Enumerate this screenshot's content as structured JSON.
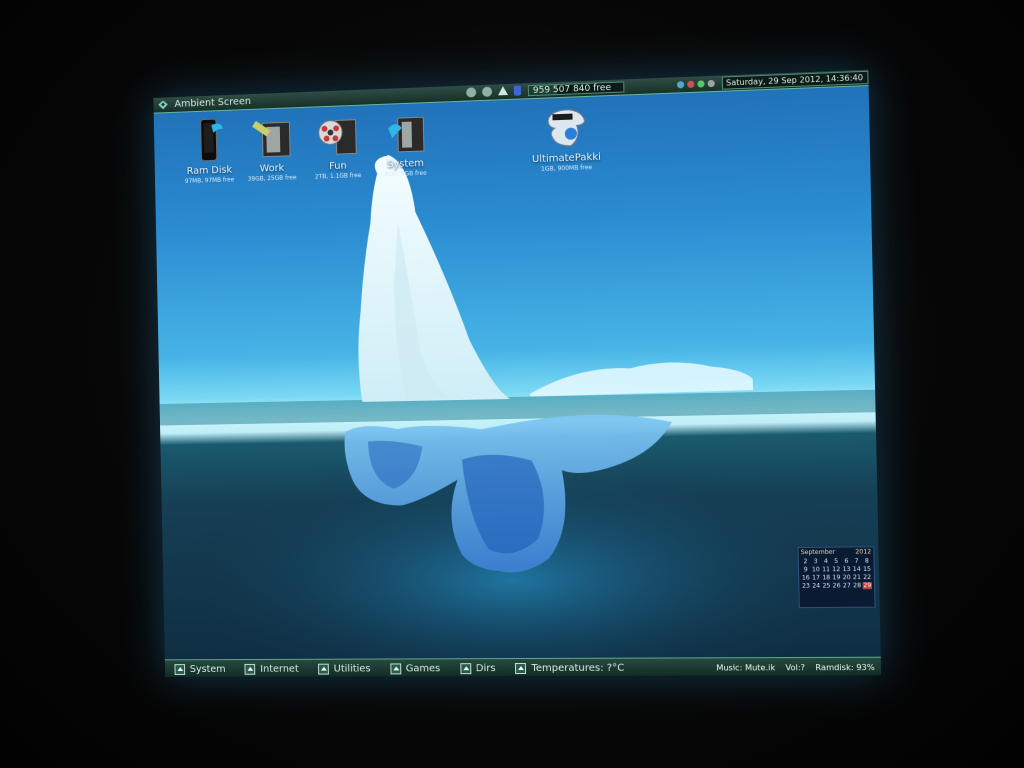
{
  "topbar": {
    "title": "Ambient Screen",
    "free_memory": "959 507 840 free",
    "clock": "Saturday, 29 Sep 2012, 14:36:40",
    "memory_used_fraction": 0.3
  },
  "desktop_icons": [
    {
      "label": "Ram Disk",
      "sub": "97MB, 97MB free",
      "icon": "ramdisk-icon"
    },
    {
      "label": "Work",
      "sub": "39GB, 25GB free",
      "icon": "work-drive-icon"
    },
    {
      "label": "Fun",
      "sub": "2TB, 1.1GB free",
      "icon": "film-reel-icon"
    },
    {
      "label": "System",
      "sub": "8GB, 6GB free",
      "icon": "system-drive-icon"
    },
    {
      "label": "UltimatePakki",
      "sub": "1GB, 900MB free",
      "icon": "ultimatepakki-icon"
    }
  ],
  "calendar": {
    "month": "September",
    "year": "2012",
    "days": [
      "2",
      "3",
      "4",
      "5",
      "6",
      "7",
      "8",
      "9",
      "10",
      "11",
      "12",
      "13",
      "14",
      "15",
      "16",
      "17",
      "18",
      "19",
      "20",
      "21",
      "22",
      "23",
      "24",
      "25",
      "26",
      "27",
      "28",
      "29"
    ],
    "today": "29"
  },
  "taskbar": {
    "items": [
      {
        "label": "System"
      },
      {
        "label": "Internet"
      },
      {
        "label": "Utilities"
      },
      {
        "label": "Games"
      },
      {
        "label": "Dirs"
      },
      {
        "label": "Temperatures: ?°C"
      }
    ],
    "right": [
      "Music: Mute.ik",
      "Vol:?",
      "Ramdisk: 93%"
    ]
  },
  "colors": {
    "sky_top": "#1f6fb6",
    "horizon": "#c9f3fc",
    "deep_water": "#0e2c40",
    "bar": "#254a40",
    "accent": "#5aa88c"
  }
}
